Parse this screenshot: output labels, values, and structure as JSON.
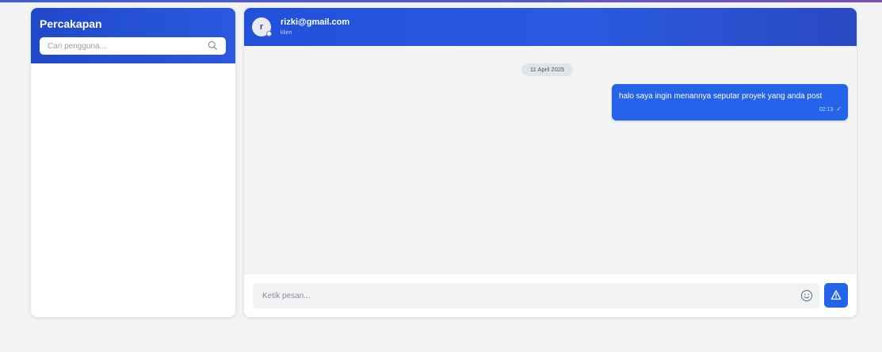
{
  "colors": {
    "accent": "#2563eb",
    "header_gradient_start": "#1f49c9",
    "background": "#f2f3f5"
  },
  "sidebar": {
    "title": "Percakapan",
    "search": {
      "placeholder": "Cari pengguna...",
      "value": "",
      "icon": "search-icon"
    }
  },
  "chat": {
    "contact": {
      "avatar_initial": "r",
      "email": "rizki@gmail.com",
      "role": "klien"
    },
    "date_label": "11 April 2025",
    "messages": [
      {
        "text": "halo saya ingin menannya seputar proyek yang anda post",
        "time": "02:13",
        "status_icon": "check-icon"
      }
    ],
    "composer": {
      "placeholder": "Ketik pesan...",
      "value": "",
      "emoji_icon": "emoji-icon",
      "send_icon": "send-icon"
    }
  }
}
